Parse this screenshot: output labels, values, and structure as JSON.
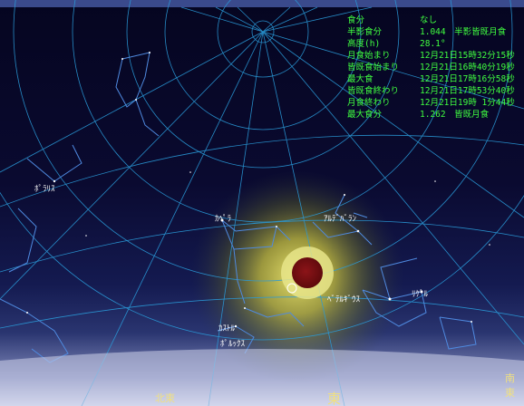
{
  "info_panel": {
    "rows": [
      {
        "key": "食分",
        "value": "なし"
      },
      {
        "key": "半影食分",
        "value": "1.044　半影皆既月食"
      },
      {
        "key": "高度(h)",
        "value": "28.1°"
      },
      {
        "key": "月食始まり",
        "value": "12月21日15時32分15秒"
      },
      {
        "key": "皆既食始まり",
        "value": "12月21日16時40分19秒"
      },
      {
        "key": "最大食",
        "value": "12月21日17時16分58秒"
      },
      {
        "key": "皆既食終わり",
        "value": "12月21日17時53分40秒"
      },
      {
        "key": "月食終わり",
        "value": "12月21日19時 1分44秒"
      },
      {
        "key": "最大食分",
        "value": "1.262　皆既月食"
      }
    ]
  },
  "star_labels": {
    "polaris": "ﾎﾟﾗﾘｽ",
    "capella": "ｶﾍﾟﾗ",
    "aldebaran": "ｱﾙﾃﾞﾊﾞﾗﾝ",
    "betelgeuse": "ﾍﾞﾃﾙｷﾞｳｽ",
    "rigel": "ﾘｹﾞﾙ",
    "castor": "ｶｽﾄﾙ",
    "pollux": "ﾎﾟﾙｯｸｽ"
  },
  "compass": {
    "northeast": "北東",
    "east": "東",
    "southeast": "南東"
  },
  "colors": {
    "grid": "#2a9ad8",
    "constellation": "#4f8ae0",
    "info_text": "#40ff40",
    "moon": "#7a0f12",
    "glow": "#e8e060"
  }
}
